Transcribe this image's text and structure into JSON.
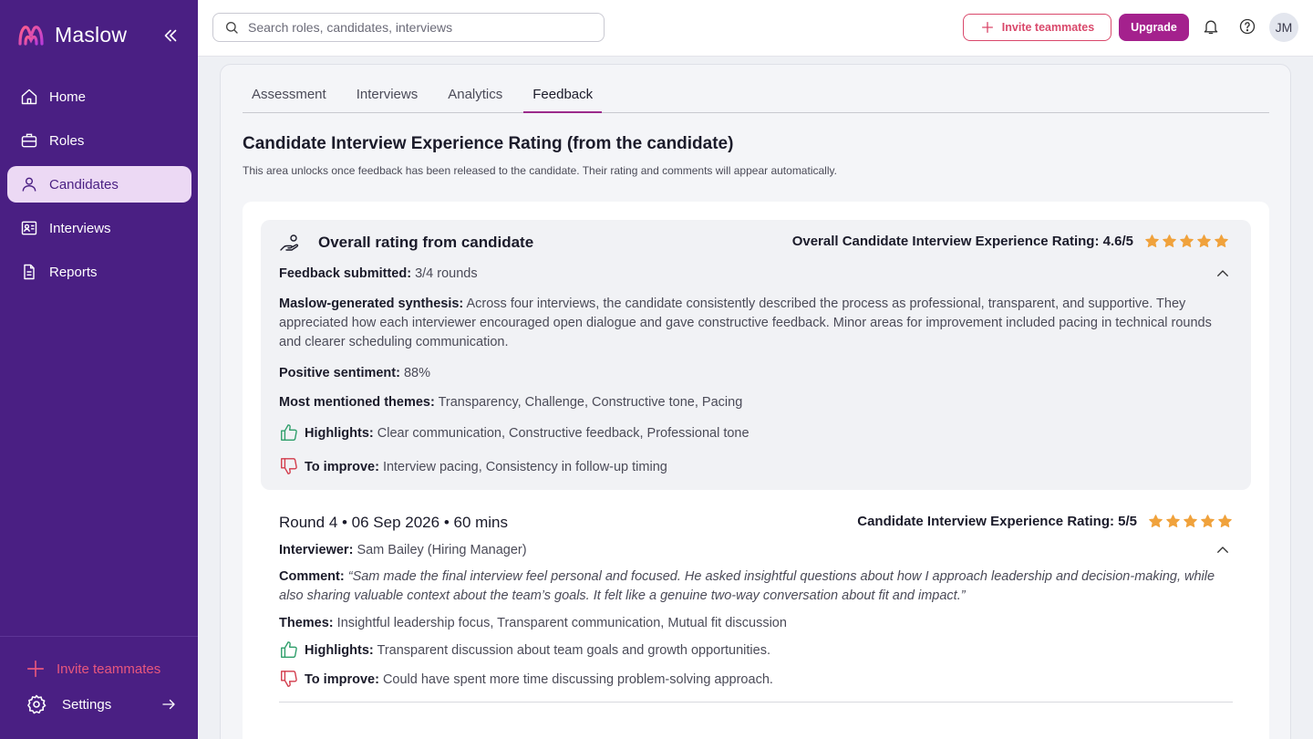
{
  "brand": {
    "name": "Maslow"
  },
  "sidebar": {
    "items": [
      {
        "label": "Home",
        "icon": "home-icon"
      },
      {
        "label": "Roles",
        "icon": "briefcase-icon"
      },
      {
        "label": "Candidates",
        "icon": "user-icon",
        "active": true
      },
      {
        "label": "Interviews",
        "icon": "id-card-icon"
      },
      {
        "label": "Reports",
        "icon": "document-icon"
      }
    ],
    "invite_label": "Invite teammates",
    "settings_label": "Settings"
  },
  "topbar": {
    "search_placeholder": "Search roles, candidates, interviews",
    "invite_label": "Invite teammates",
    "upgrade_label": "Upgrade",
    "avatar_initials": "JM"
  },
  "tabs": [
    "Assessment",
    "Interviews",
    "Analytics",
    "Feedback"
  ],
  "active_tab": "Feedback",
  "section": {
    "title_bold": "Candidate Interview Experience Rating",
    "title_rest": "(from the candidate)",
    "subtitle": "This area unlocks once feedback has been released to the candidate. Their rating and comments will appear automatically."
  },
  "overall": {
    "title": "Overall rating from candidate",
    "rating_label": "Overall Candidate Interview Experience Rating: 4.6/5",
    "rating_value": 4.6,
    "rating_max": 5,
    "feedback_label": "Feedback submitted:",
    "feedback_value": "3/4 rounds",
    "synthesis_label": "Maslow-generated synthesis:",
    "synthesis_text": "Across four interviews, the candidate consistently described the process as professional, transparent, and supportive. They appreciated how each interviewer encouraged open dialogue and gave constructive feedback. Minor areas for improvement included pacing in technical rounds and clearer scheduling communication.",
    "sentiment_label": "Positive sentiment:",
    "sentiment_value": "88%",
    "themes_label": "Most mentioned themes:",
    "themes_value": "Transparency, Challenge, Constructive tone, Pacing",
    "highlights_label": "Highlights:",
    "highlights_value": "Clear communication, Constructive feedback, Professional tone",
    "improve_label": "To improve:",
    "improve_value": "Interview pacing, Consistency in follow-up timing"
  },
  "round": {
    "title": "Round 4 • 06 Sep 2026 • 60 mins",
    "rating_label": "Candidate Interview Experience Rating: 5/5",
    "rating_value": 5,
    "rating_max": 5,
    "interviewer_label": "Interviewer:",
    "interviewer_value": "Sam Bailey (Hiring Manager)",
    "comment_label": "Comment:",
    "comment_value": "“Sam made the final interview feel personal and focused. He asked insightful questions about how I approach leadership and decision-making, while also sharing valuable context about the team’s goals. It felt like a genuine two-way conversation about fit and impact.”",
    "themes_label": "Themes:",
    "themes_value": "Insightful leadership focus, Transparent communication, Mutual fit discussion",
    "highlights_label": "Highlights:",
    "highlights_value": "Transparent discussion about team goals and growth opportunities.",
    "improve_label": "To improve:",
    "improve_value": "Could have spent more time discussing problem-solving approach."
  },
  "colors": {
    "sidebar_bg": "#4a1f83",
    "accent": "#a4218d",
    "invite": "#d9486b",
    "star": "#f0a23c",
    "thumb_up": "#2e9e6a",
    "thumb_down": "#d23a4a"
  }
}
